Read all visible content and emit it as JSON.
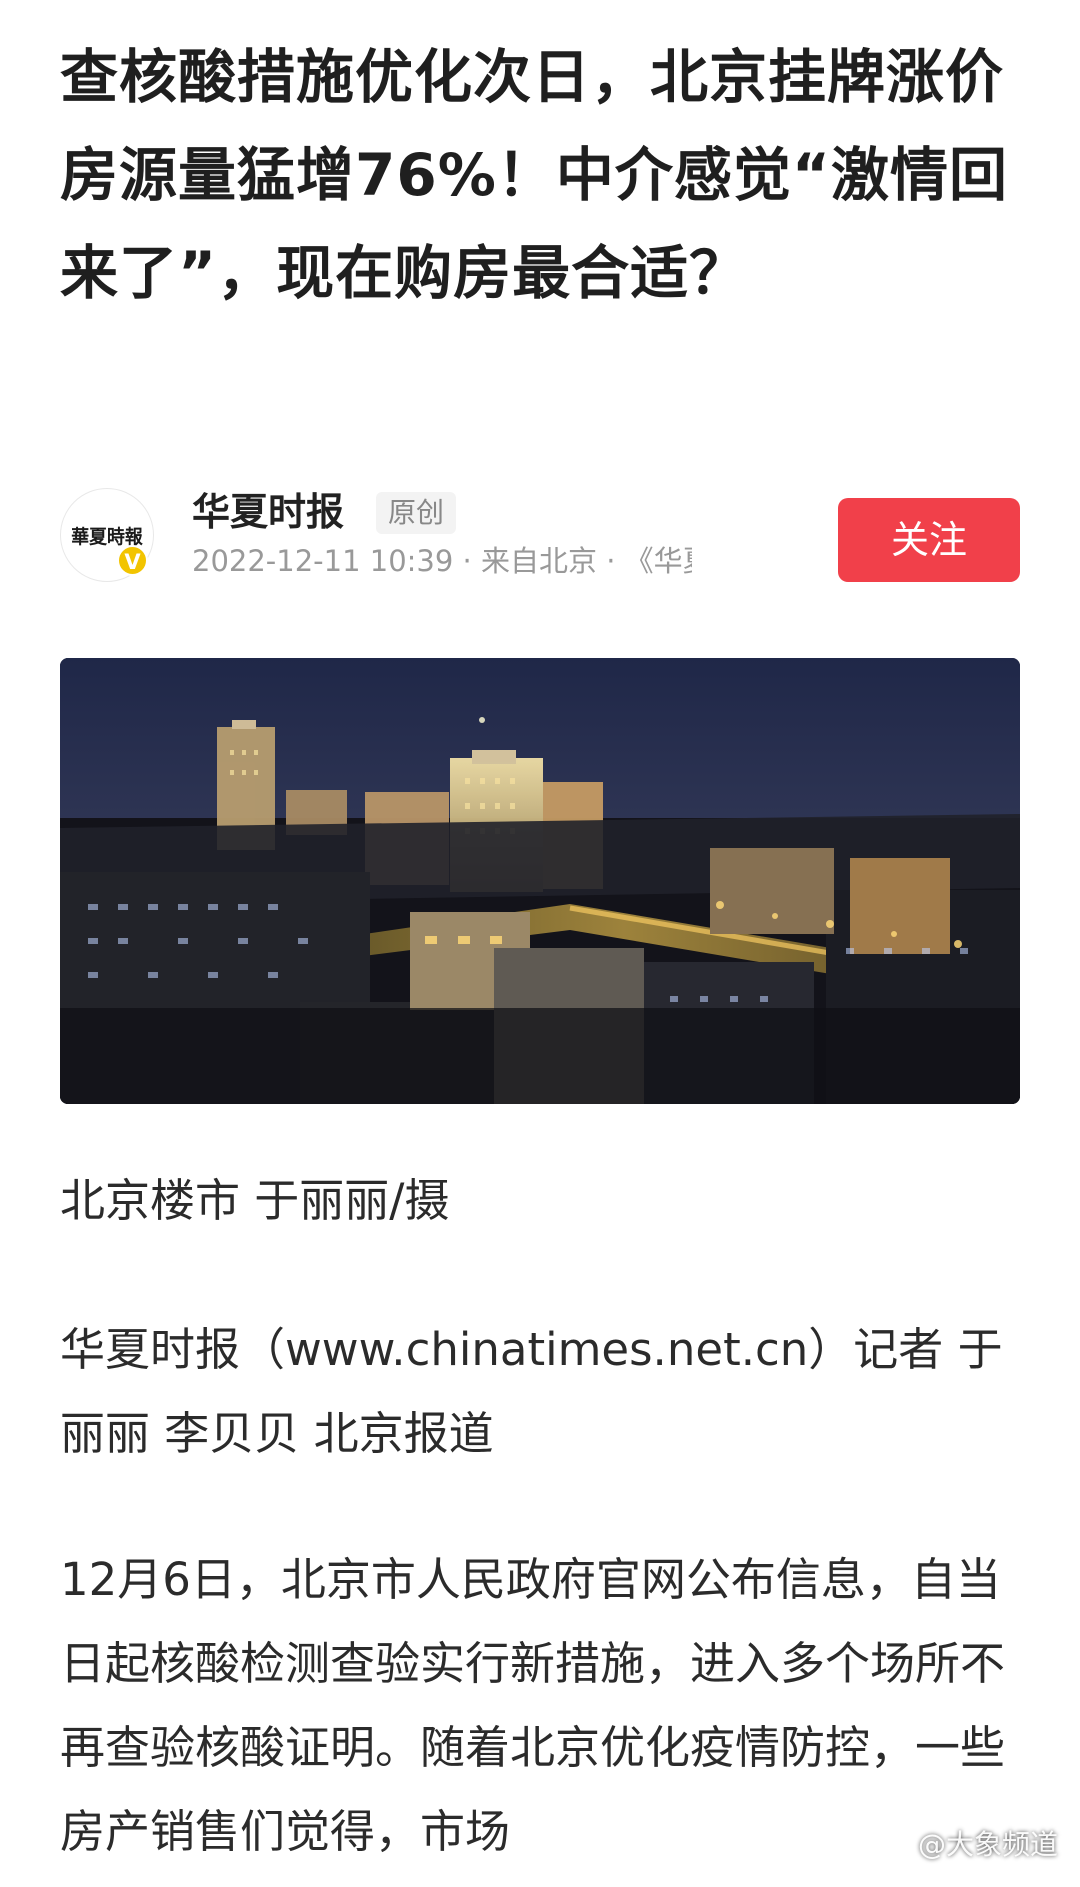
{
  "article": {
    "headline": "查核酸措施优化次日，北京挂牌涨价房源量猛增76%！中介感觉“激情回来了”，现在购房最合适？",
    "author": {
      "logo_text": "華夏時報",
      "verified_mark": "V",
      "name": "华夏时报",
      "tag": "原创",
      "meta": "2022-12-11 10:39 · 来自北京 · 《华夏…",
      "follow_label": "关注"
    },
    "image": {
      "icon": "night-city-photo",
      "caption": "北京楼市 于丽丽/摄"
    },
    "reporter_line": "华夏时报（www.chinatimes.net.cn）记者 于丽丽 李贝贝 北京报道",
    "paragraph": "12月6日，北京市人民政府官网公布信息，自当日起核酸检测查验实行新措施，进入多个场所不再查验核酸证明。随着北京优化疫情防控，一些房产销售们觉得，市场"
  },
  "watermark": "@大象频道",
  "colors": {
    "follow_button": "#f1404a",
    "verified_badge": "#f2c400",
    "headline": "#1f1f1f",
    "meta": "#999999"
  }
}
